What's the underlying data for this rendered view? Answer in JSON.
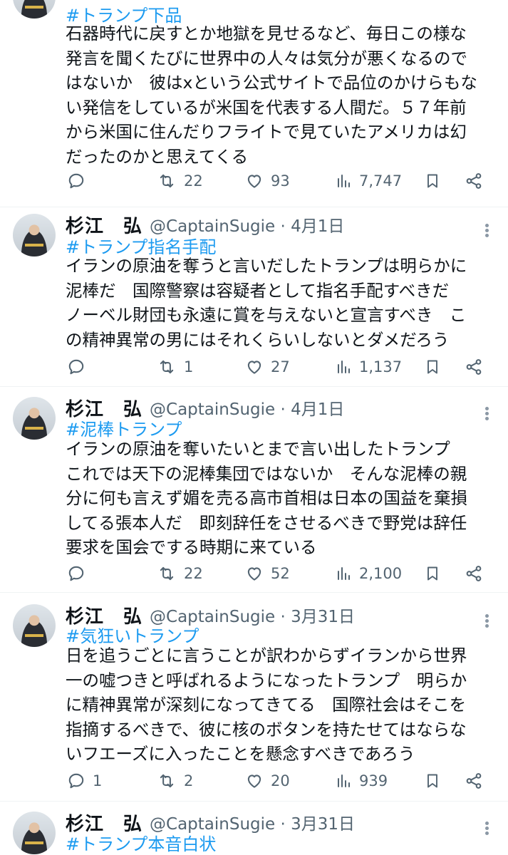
{
  "tweets": [
    {
      "name": "",
      "handle": "",
      "hashtag": "#トランプ下品",
      "lines": [
        "石器時代に戻すとか地獄を見せるなど、毎日この様な",
        "発言を聞くたびに世界中の人々は気分が悪くなるので",
        "はないか　彼はxという公式サイトで品位のかけらもな",
        "い発信をしているが米国を代表する人間だ。５７年前",
        "から米国に住んだりフライトで見ていたアメリカは幻",
        "だったのかと思えてくる"
      ],
      "replies": "",
      "retweets": "22",
      "likes": "93",
      "views": "7,747"
    },
    {
      "name": "杉江　弘",
      "handle": "@CaptainSugie · 4月1日",
      "hashtag": "#トランプ指名手配",
      "lines": [
        "イランの原油を奪うと言いだしたトランプは明らかに",
        "泥棒だ　国際警察は容疑者として指名手配すべきだ",
        "ノーベル財団も永遠に賞を与えないと宣言すべき　こ",
        "の精神異常の男にはそれくらいしないとダメだろう"
      ],
      "replies": "",
      "retweets": "1",
      "likes": "27",
      "views": "1,137"
    },
    {
      "name": "杉江　弘",
      "handle": "@CaptainSugie · 4月1日",
      "hashtag": "#泥棒トランプ",
      "lines": [
        "イランの原油を奪いたいとまで言い出したトランプ",
        "これでは天下の泥棒集団ではないか　そんな泥棒の親",
        "分に何も言えず媚を売る高市首相は日本の国益を棄損",
        "してる張本人だ　即刻辞任をさせるべきで野党は辞任",
        "要求を国会でする時期に来ている"
      ],
      "replies": "",
      "retweets": "22",
      "likes": "52",
      "views": "2,100"
    },
    {
      "name": "杉江　弘",
      "handle": "@CaptainSugie · 3月31日",
      "hashtag": "#気狂いトランプ",
      "lines": [
        "日を追うごとに言うことが訳わからずイランから世界",
        "一の嘘つきと呼ばれるようになったトランプ　明らか",
        "に精神異常が深刻になってきてる　国際社会はそこを",
        "指摘するべきで、彼に核のボタンを持たせてはならな",
        "いフエーズに入ったことを懸念すべきであろう"
      ],
      "replies": "1",
      "retweets": "2",
      "likes": "20",
      "views": "939"
    },
    {
      "name": "杉江　弘",
      "handle": "@CaptainSugie · 3月31日",
      "hashtag": "#トランプ本音白状",
      "lines": [],
      "replies": "",
      "retweets": "",
      "likes": "",
      "views": ""
    }
  ],
  "icons": {
    "reply": "reply-icon",
    "retweet": "retweet-icon",
    "like": "heart-icon",
    "views": "views-chart-icon",
    "bookmark": "bookmark-icon",
    "share": "share-icon",
    "more": "more-dots-icon"
  },
  "colors": {
    "hashtag": "#1d9bf0",
    "secondary_text": "#536471",
    "divider": "#eff3f4"
  }
}
